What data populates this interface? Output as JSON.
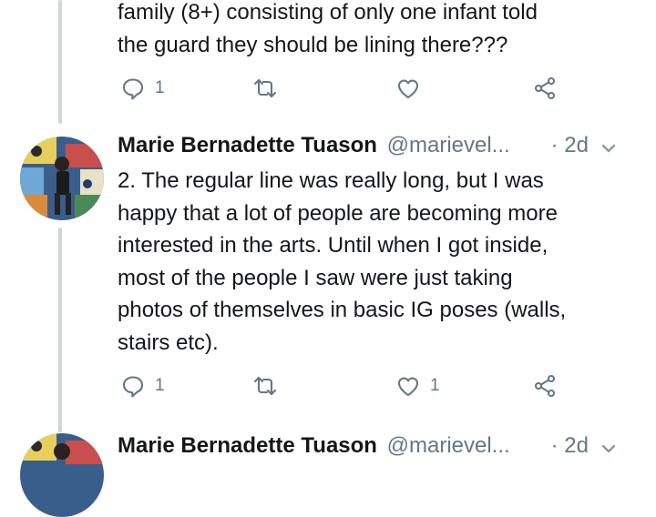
{
  "tweet1": {
    "text_lines": [
      "family (8+) consisting of only one infant told",
      "the guard they should be lining there???"
    ],
    "actions": {
      "reply_count": "1",
      "retweet_count": "",
      "like_count": ""
    }
  },
  "tweet2": {
    "author_name": "Marie Bernadette Tuason",
    "handle": "@marievel...",
    "time": "· 2d",
    "text_lines": [
      "2. The regular line was really long, but I was",
      "happy that a lot of people are becoming more",
      "interested in the arts. Until when I got inside,",
      "most of the people I saw were just taking",
      "photos of themselves in basic IG poses (walls,",
      "stairs etc)."
    ],
    "actions": {
      "reply_count": "1",
      "retweet_count": "",
      "like_count": "1"
    }
  },
  "tweet3": {
    "author_name": "Marie Bernadette Tuason",
    "handle": "@marievel...",
    "time": "· 2d"
  },
  "icons": {
    "reply": "reply-icon",
    "retweet": "retweet-icon",
    "like": "heart-icon",
    "share": "share-icon",
    "caret": "chevron-down-icon"
  },
  "colors": {
    "text": "#14171a",
    "muted": "#657786",
    "thread_line": "#ccd6dd"
  }
}
